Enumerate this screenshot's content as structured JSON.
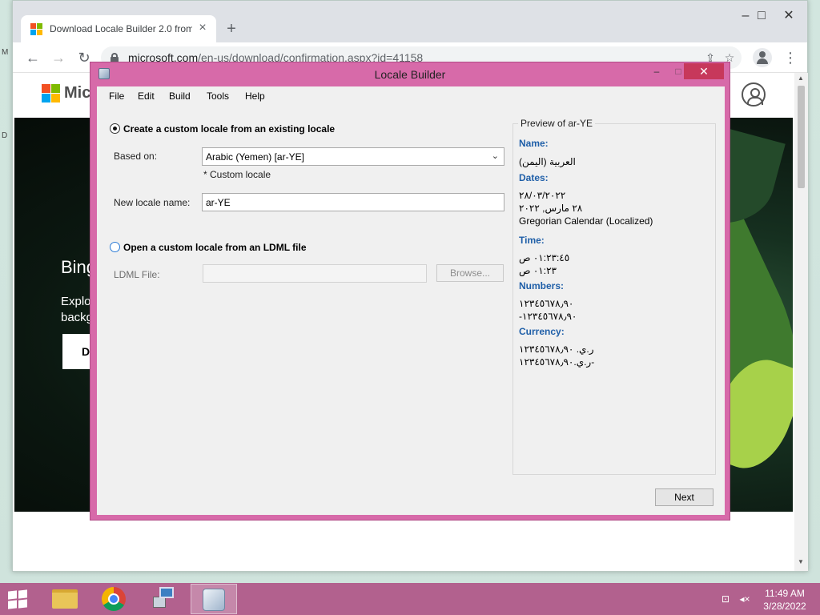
{
  "browser": {
    "tab_title": "Download Locale Builder 2.0 from",
    "tab_close": "×",
    "new_tab": "+",
    "url_host": "microsoft.com",
    "url_path": "/en-us/download/confirmation.aspx?id=41158",
    "win_minimize": "–",
    "win_maximize": "□",
    "win_close": "✕",
    "back": "←",
    "forward": "→",
    "reload": "↻",
    "menu": "⋮"
  },
  "page": {
    "brand": "Micr",
    "hero_title": "Bing",
    "hero_text_1": "Explo",
    "hero_text_2": "backg",
    "hero_button": "D"
  },
  "dialog": {
    "title": "Locale Builder",
    "minimize": "–",
    "maximize": "□",
    "close": "✕",
    "menu": [
      "File",
      "Edit",
      "Build",
      "Tools",
      "Help"
    ],
    "option_existing": "Create a custom locale from an existing locale",
    "based_on_label": "Based on:",
    "based_on_value": "Arabic (Yemen) [ar-YE]",
    "custom_locale_note": "* Custom locale",
    "new_name_label": "New locale name:",
    "new_name_value": "ar-YE",
    "option_ldml": "Open a custom locale from an LDML file",
    "ldml_label": "LDML File:",
    "ldml_value": "",
    "browse_label": "Browse...",
    "next_label": "Next",
    "preview": {
      "legend": "Preview of ar-YE",
      "name_head": "Name:",
      "name_value": "العربية (اليمن)",
      "dates_head": "Dates:",
      "date_short": "٢٨/٠٣/٢٠٢٢",
      "date_long": "٢٨ مارس, ٢٠٢٢",
      "calendar": "Gregorian Calendar (Localized)",
      "time_head": "Time:",
      "time_long": "٠١:٢٣:٤٥ ص",
      "time_short": "٠١:٢٣ ص",
      "numbers_head": "Numbers:",
      "number_pos": "١٢٣٤٥٦٧٨٫٩٠",
      "number_neg": "-١٢٣٤٥٦٧٨٫٩٠",
      "currency_head": "Currency:",
      "currency_pos": "ر.ي. ١٢٣٤٥٦٧٨٫٩٠",
      "currency_neg": "ر.ي.١٢٣٤٥٦٧٨٫٩٠-"
    }
  },
  "taskbar": {
    "time": "11:49 AM",
    "date": "3/28/2022"
  }
}
